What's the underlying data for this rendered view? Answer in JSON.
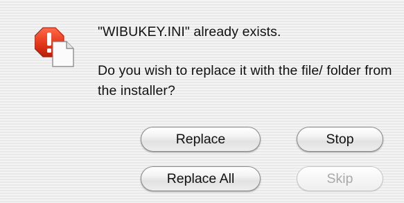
{
  "dialog": {
    "icon": "alert-stop-document-icon",
    "title": "\"WIBUKEY.INI\" already exists.",
    "body": "Do you wish to replace it with the file/ folder from the installer?",
    "buttons": {
      "replace": {
        "label": "Replace",
        "enabled": true
      },
      "stop": {
        "label": "Stop",
        "enabled": true
      },
      "replace_all": {
        "label": "Replace All",
        "enabled": true
      },
      "skip": {
        "label": "Skip",
        "enabled": false
      }
    }
  },
  "colors": {
    "alert_red": "#e4361a",
    "disabled_text": "#a9a9a9"
  }
}
